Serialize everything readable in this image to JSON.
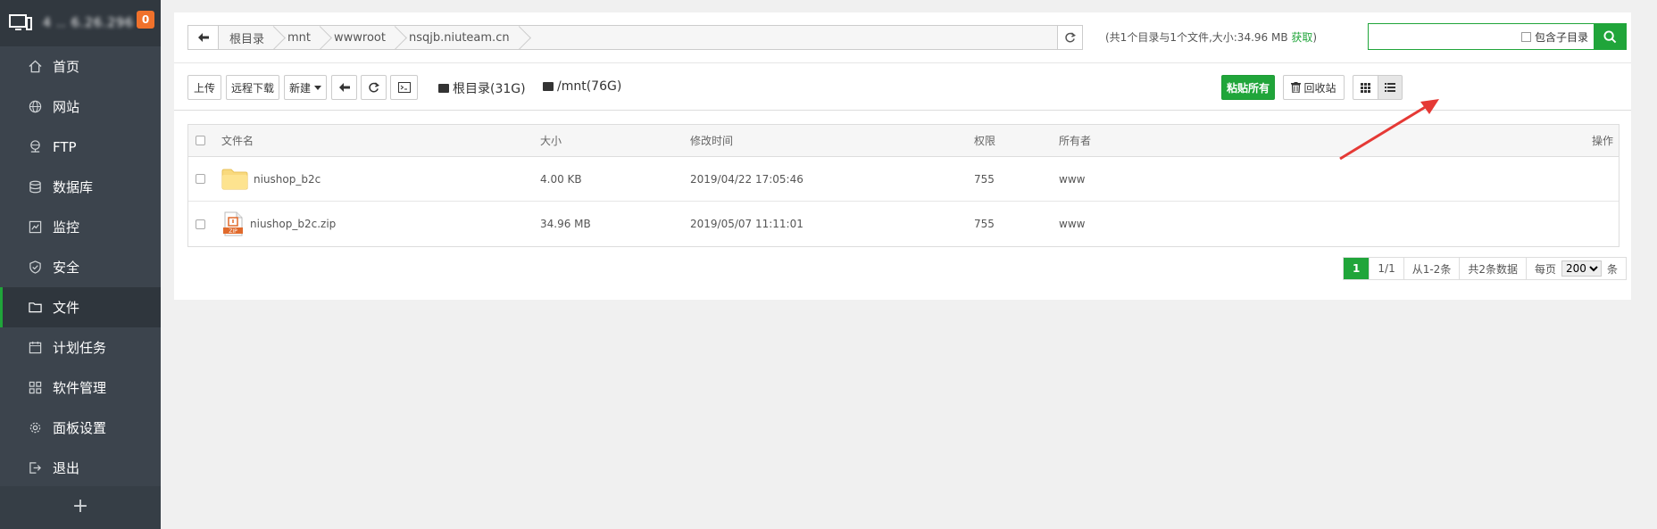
{
  "sidebar": {
    "ip_label": "4 .. 6.26.296",
    "badge": "0",
    "items": [
      {
        "label": "首页",
        "icon": "home-icon"
      },
      {
        "label": "网站",
        "icon": "globe-icon"
      },
      {
        "label": "FTP",
        "icon": "ftp-icon"
      },
      {
        "label": "数据库",
        "icon": "database-icon"
      },
      {
        "label": "监控",
        "icon": "monitor-chart-icon"
      },
      {
        "label": "安全",
        "icon": "shield-icon"
      },
      {
        "label": "文件",
        "icon": "folder-icon"
      },
      {
        "label": "计划任务",
        "icon": "calendar-icon"
      },
      {
        "label": "软件管理",
        "icon": "grid-icon"
      },
      {
        "label": "面板设置",
        "icon": "gear-icon"
      },
      {
        "label": "退出",
        "icon": "logout-icon"
      }
    ],
    "active_index": 6,
    "plus_label": "+"
  },
  "breadcrumb": [
    "根目录",
    "mnt",
    "wwwroot",
    "nsqjb.niuteam.cn"
  ],
  "dir_info": {
    "text": "(共1个目录与1个文件,大小:34.96 MB ",
    "fetch": "获取",
    "close": ")"
  },
  "search": {
    "placeholder": "",
    "subdir_label": "包含子目录"
  },
  "toolbar": {
    "upload": "上传",
    "remote_download": "远程下载",
    "new": "新建",
    "disk1": "根目录(31G)",
    "disk2": "/mnt(76G)",
    "paste_all": "粘贴所有",
    "recycle": "回收站"
  },
  "table": {
    "headers": {
      "name": "文件名",
      "size": "大小",
      "mtime": "修改时间",
      "perm": "权限",
      "owner": "所有者",
      "ops": "操作"
    },
    "rows": [
      {
        "name": "niushop_b2c",
        "size": "4.00 KB",
        "mtime": "2019/04/22 17:05:46",
        "perm": "755",
        "owner": "www",
        "type": "folder"
      },
      {
        "name": "niushop_b2c.zip",
        "size": "34.96 MB",
        "mtime": "2019/05/07 11:11:01",
        "perm": "755",
        "owner": "www",
        "type": "zip"
      }
    ]
  },
  "pager": {
    "current": "1",
    "pages": "1/1",
    "range": "从1-2条",
    "total": "共2条数据",
    "per_page_label": "每页",
    "per_page": "200",
    "unit": "条"
  },
  "colors": {
    "accent": "#20a53a",
    "sidebar": "#3c444d",
    "badge": "#f0712b",
    "arrow": "#e53935"
  }
}
